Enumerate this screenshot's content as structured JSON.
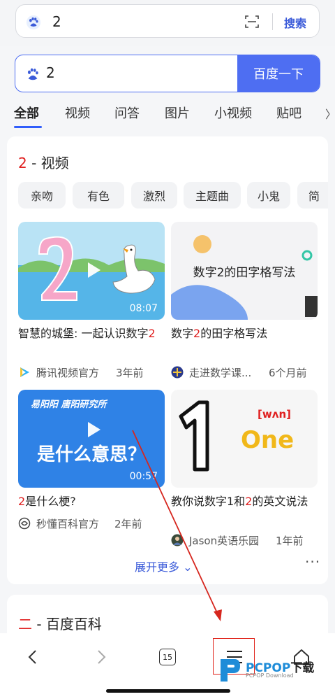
{
  "top_bar": {
    "query": "2",
    "search_label": "搜索"
  },
  "page_search": {
    "query": "2",
    "button_label": "百度一下"
  },
  "tabs": [
    {
      "label": "全部",
      "active": true
    },
    {
      "label": "视频"
    },
    {
      "label": "问答"
    },
    {
      "label": "图片"
    },
    {
      "label": "小视频"
    },
    {
      "label": "贴吧"
    }
  ],
  "video_section": {
    "title_hl": "2",
    "title_rest": " - 视频",
    "chips": [
      "亲吻",
      "有色",
      "激烈",
      "主题曲",
      "小鬼",
      "简"
    ],
    "videos": [
      {
        "thumb_text": "",
        "duration": "08:07",
        "title_pre": "智慧的城堡: 一起认识数字",
        "title_hl": "2",
        "title_post": "",
        "source": "腾讯视频官方",
        "time": "3年前"
      },
      {
        "thumb_text": "数字2的田字格写法",
        "duration": "",
        "title_pre": "数字",
        "title_hl": "2",
        "title_post": "的田字格写法",
        "source": "走进数学课...",
        "time": "6个月前"
      },
      {
        "thumb_text": "是什么意思？",
        "thumb_top": "易阳阳 唐阳研究所",
        "duration": "00:57",
        "title_pre": "",
        "title_hl": "2",
        "title_post": "是什么梗?",
        "source": "秒懂百科官方",
        "time": "2年前"
      },
      {
        "thumb_text": "One",
        "thumb_top": "[wʌn]",
        "duration": "",
        "title_pre": "教你说数字1和",
        "title_hl": "2",
        "title_post": "的英文说法",
        "source": "Jason英语乐园",
        "time": "1年前"
      }
    ],
    "expand_label": "展开更多 ⌄",
    "more_label": "···"
  },
  "baike_section": {
    "title_hl": "二",
    "title_rest": " - 百度百科"
  },
  "bottom_nav": {
    "tab_count": "15"
  },
  "watermark": {
    "brand": "PCPOP",
    "suffix": "下载",
    "sub": "PCPOP Download"
  },
  "colors": {
    "accent": "#4e6ef2",
    "highlight": "#e02020"
  }
}
